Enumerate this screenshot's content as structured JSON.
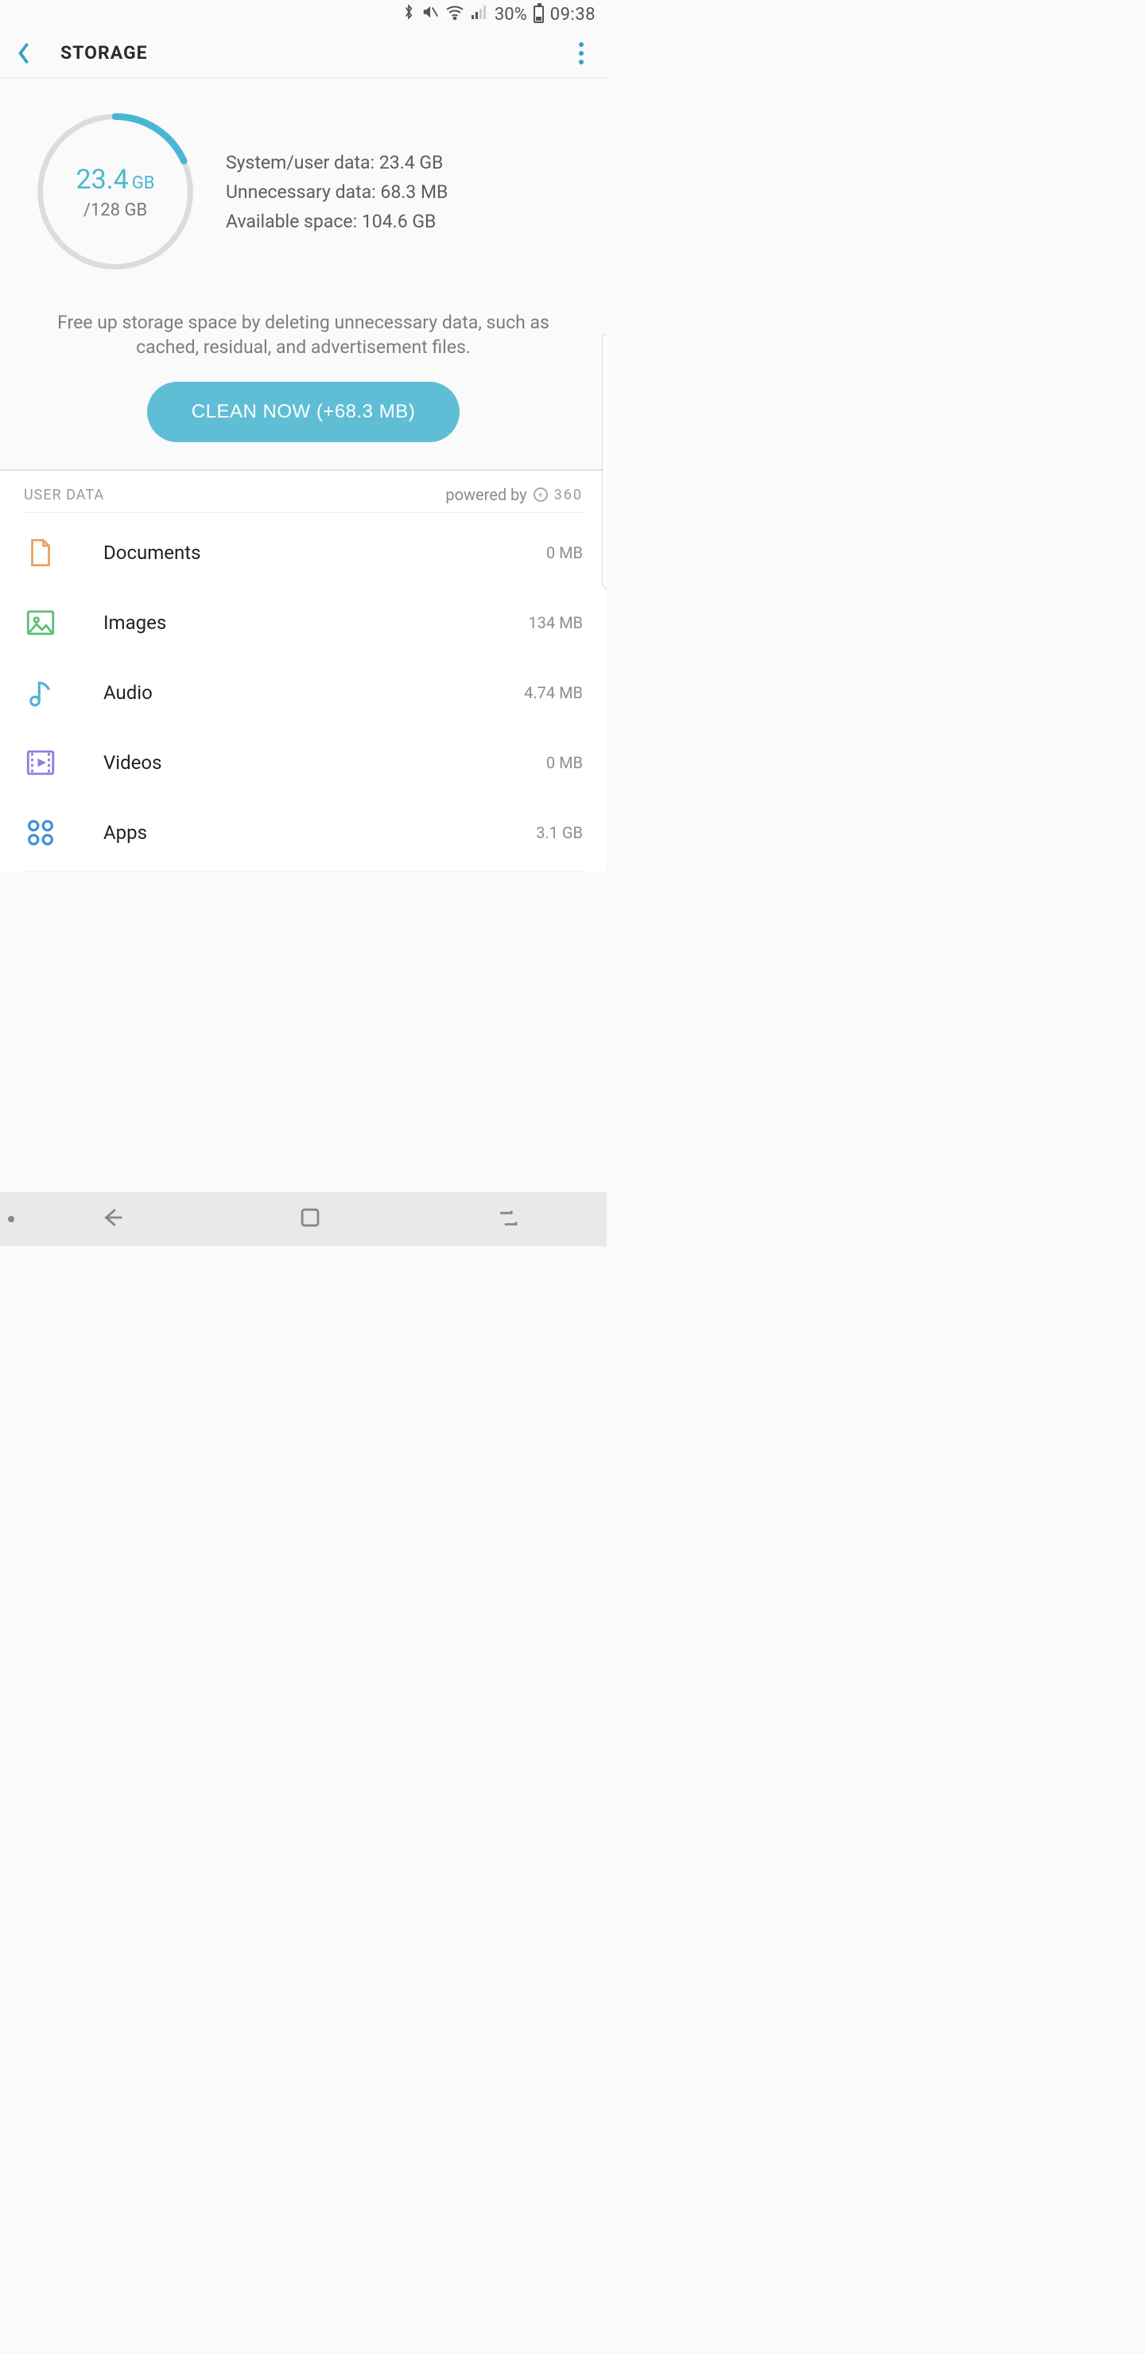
{
  "status_bar": {
    "battery_percent": "30%",
    "time": "09:38"
  },
  "header": {
    "title": "STORAGE"
  },
  "summary": {
    "used_value": "23.4",
    "used_unit": "GB",
    "total": "/128 GB",
    "used_fraction": 0.183,
    "rows": {
      "system_label": "System/user data:",
      "system_value": "23.4 GB",
      "unnecessary_label": "Unnecessary data:",
      "unnecessary_value": "68.3 MB",
      "available_label": "Available space:",
      "available_value": "104.6 GB"
    }
  },
  "hint": "Free up storage space by deleting unnecessary data, such as cached, residual, and advertisement files.",
  "clean_button": "CLEAN NOW (+68.3 MB)",
  "user_data": {
    "section_label": "USER DATA",
    "powered_by_label": "powered by",
    "powered_by_brand": "360",
    "items": [
      {
        "icon": "document",
        "name": "Documents",
        "size": "0 MB"
      },
      {
        "icon": "image",
        "name": "Images",
        "size": "134 MB"
      },
      {
        "icon": "audio",
        "name": "Audio",
        "size": "4.74 MB"
      },
      {
        "icon": "video",
        "name": "Videos",
        "size": "0 MB"
      },
      {
        "icon": "apps",
        "name": "Apps",
        "size": "3.1 GB"
      }
    ]
  },
  "colors": {
    "accent": "#5fbed6",
    "text_muted": "#7d7d7d"
  }
}
